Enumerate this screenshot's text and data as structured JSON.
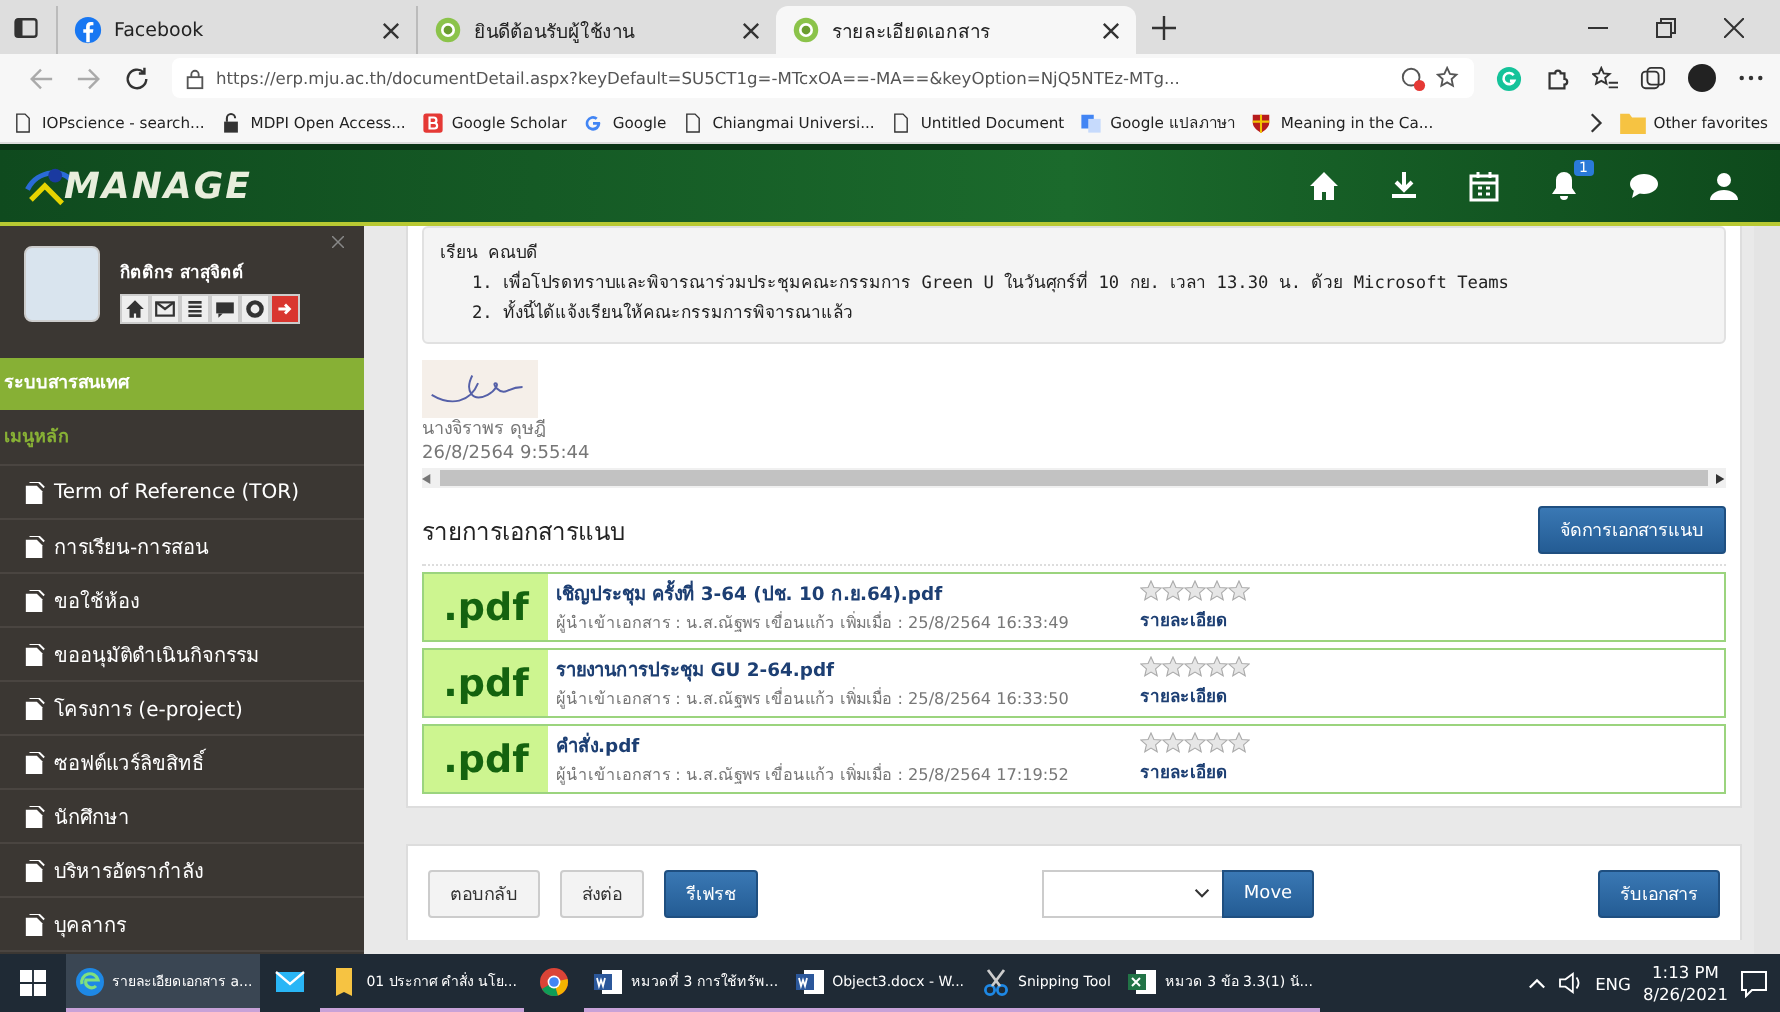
{
  "browser": {
    "tabs": [
      {
        "label": "Facebook",
        "selected": false
      },
      {
        "label": "ยินดีต้อนรับผู้ใช้งาน",
        "selected": false
      },
      {
        "label": "รายละเอียดเอกสาร",
        "selected": true
      }
    ],
    "url": "https://erp.mju.ac.th/documentDetail.aspx?keyDefault=SU5CT1g=-MTcxOA==-MA==&keyOption=NjQ5NTEz-MTg...",
    "bookmarks": [
      "IOPscience - search...",
      "MDPI Open Access...",
      "Google Scholar",
      "Google",
      "Chiangmai Universi...",
      "Untitled Document",
      "Google แปลภาษา",
      "Meaning in the Ca..."
    ],
    "other_bookmarks": "Other favorites"
  },
  "header": {
    "logo": "MANAGE",
    "notification_count": "1"
  },
  "profile": {
    "name": "กิตติกร สาสุจิตต์"
  },
  "sidebar": {
    "section": "ระบบสารสนเทศ",
    "heading": "เมนูหลัก",
    "items": [
      "Term of Reference (TOR)",
      "การเรียน-การสอน",
      "ขอใช้ห้อง",
      "ขออนุมัติดำเนินกิจกรรม",
      "โครงการ (e-project)",
      "ซอฟต์แวร์ลิขสิทธิ์",
      "นักศึกษา",
      "บริหารอัตรากำลัง",
      "บุคลากร"
    ]
  },
  "message": {
    "salutation": "เรียน คณบดี",
    "lines": [
      "1. เพื่อโปรดทราบและพิจารณาร่วมประชุมคณะกรรมการ Green U ในวันศุกร์ที่ 10 กย. เวลา 13.30 น. ด้วย Microsoft Teams",
      "2. ทั้งนี้ได้แจ้งเรียนให้คณะกรรมการพิจารณาแล้ว"
    ],
    "signer": "นางจิราพร ดุษฎี",
    "signed_at": "26/8/2564 9:55:44"
  },
  "attachments": {
    "title": "รายการเอกสารแนบ",
    "manage_button": "จัดการเอกสารแนบ",
    "items": [
      {
        "type": ".pdf",
        "name": "เชิญประชุม ครั้งที่ 3-64 (ปช. 10 ก.ย.64).pdf",
        "uploader_label": "ผู้นำเข้าเอกสาร :",
        "uploader": "น.ส.ณัฐพร เขื่อนแก้ว",
        "added_label": "เพิ่มเมื่อ :",
        "added": "25/8/2564 16:33:49",
        "stars": 0,
        "details": "รายละเอียด"
      },
      {
        "type": ".pdf",
        "name": "รายงานการประชุม GU 2-64.pdf",
        "uploader_label": "ผู้นำเข้าเอกสาร :",
        "uploader": "น.ส.ณัฐพร เขื่อนแก้ว",
        "added_label": "เพิ่มเมื่อ :",
        "added": "25/8/2564 16:33:50",
        "stars": 0,
        "details": "รายละเอียด"
      },
      {
        "type": ".pdf",
        "name": "คำสั่ง.pdf",
        "uploader_label": "ผู้นำเข้าเอกสาร :",
        "uploader": "น.ส.ณัฐพร เขื่อนแก้ว",
        "added_label": "เพิ่มเมื่อ :",
        "added": "25/8/2564 17:19:52",
        "stars": 0,
        "details": "รายละเอียด"
      }
    ]
  },
  "actions": {
    "buttons": [
      {
        "label": "ตอบกลับ",
        "kind": "default"
      },
      {
        "label": "ส่งต่อ",
        "kind": "default"
      },
      {
        "label": "รีเฟรช",
        "kind": "primary"
      }
    ],
    "move_button": "Move",
    "receive_button": "รับเอกสาร"
  },
  "taskbar": {
    "items": [
      {
        "label": "รายละเอียดเอกสาร a...",
        "active": true
      },
      {
        "active": false
      },
      {
        "label": "01 ประกาศ คำสั่ง นโย...",
        "active": false
      },
      {
        "active": false
      },
      {
        "label": "หมวดที่ 3 การใช้ทรัพ...",
        "active": false
      },
      {
        "label": "Object3.docx - W...",
        "active": false
      },
      {
        "label": "Snipping Tool",
        "active": false
      },
      {
        "label": "หมวด 3 ข้อ 3.3(1) นั...",
        "active": false
      }
    ],
    "language": "ENG",
    "time": "1:13 PM",
    "date": "8/26/2021"
  }
}
